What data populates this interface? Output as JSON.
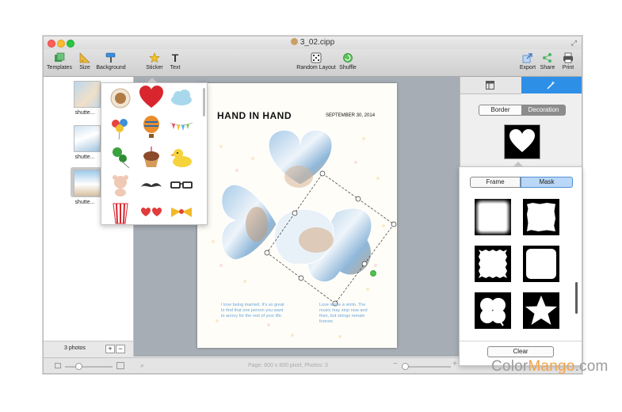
{
  "window": {
    "title": "3_02.cipp"
  },
  "toolbar": {
    "templates": "Templates",
    "size": "Size",
    "background": "Background",
    "sticker": "Sticker",
    "text": "Text",
    "random_layout": "Random Layout",
    "shuffle": "Shuffle",
    "export": "Export",
    "share": "Share",
    "print": "Print"
  },
  "sidebar": {
    "photos": [
      {
        "label": "shutte..."
      },
      {
        "label": "shutte..."
      },
      {
        "label": "shutte..."
      }
    ],
    "count_label": "3 photos",
    "add": "+",
    "remove": "−"
  },
  "page": {
    "title": "HAND IN HAND",
    "date": "SEPTEMBER 30, 2014",
    "quote_left": "I love being married. It's so great to find that one person you want to annoy for the rest of your life.",
    "quote_right": "Love is like a violin. The music may stop now and then, but strings remain forever."
  },
  "right_panel": {
    "segments": {
      "border": "Border",
      "decoration": "Decoration"
    }
  },
  "mask_popover": {
    "tabs": {
      "frame": "Frame",
      "mask": "Mask"
    },
    "clear": "Clear"
  },
  "status": {
    "text": "Page: 600 x 800 pixel, Photos: 3"
  },
  "colors": {
    "accent_blue": "#2e8fe6",
    "selection": "#3b8ee0"
  },
  "watermark": {
    "part1": "Color",
    "part2": "Mango",
    "part3": ".com"
  }
}
